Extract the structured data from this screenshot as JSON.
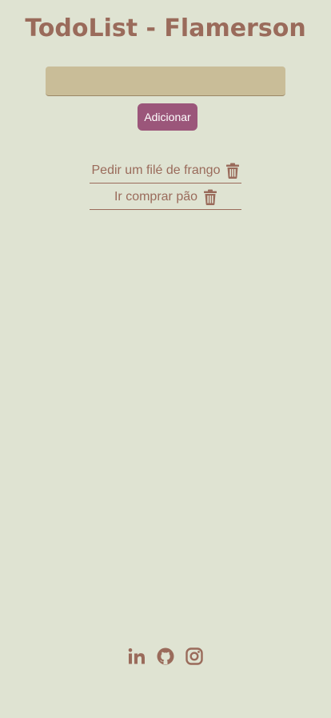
{
  "header": {
    "title": "TodoList - Flamerson"
  },
  "form": {
    "input_value": "",
    "add_label": "Adicionar"
  },
  "todos": [
    {
      "text": "Pedir um filé de frango",
      "delete_icon": "trash-icon"
    },
    {
      "text": "Ir comprar pão",
      "delete_icon": "trash-icon"
    }
  ],
  "footer": {
    "icons": [
      "linkedin-icon",
      "github-icon",
      "instagram-icon"
    ]
  },
  "colors": {
    "background": "#dfe3d2",
    "accent": "#9a6b5b",
    "input_bg": "#c9bd98",
    "button": "#9b567a"
  }
}
